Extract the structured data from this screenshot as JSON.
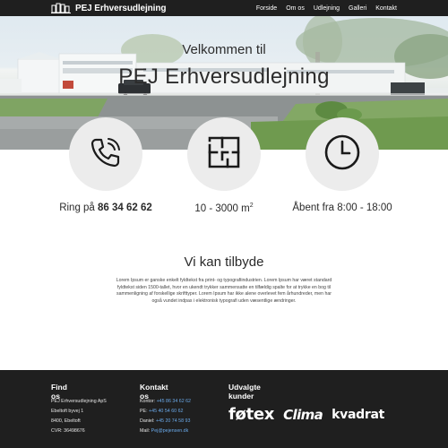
{
  "nav": {
    "brand": "PEJ Erhversudlejning",
    "menu": [
      "Forside",
      "Om os",
      "Udlejning",
      "Galleri",
      "Kontakt"
    ]
  },
  "hero": {
    "welcome": "Velkommen til",
    "title": "PEJ Erhversudlejning"
  },
  "features": {
    "phone_prefix": "Ring på",
    "phone_number": "86 34 62 62",
    "area": "10 - 3000 m",
    "area_unit_sup": "2",
    "hours": "Åbent fra 8:00 - 18:00"
  },
  "about": {
    "title": "Vi kan tilbyde",
    "text": "Lorem Ipsum er ganske enkelt fyldtekst fra print- og typografiindustrien. Lorem Ipsum har været standard fyldtekst siden 1500-tallet, hvor en ukendt trykker sammensatte en tilfældig spalte for at trykke en bog til sammenligning af forskellige skrifttyper. Lorem Ipsum har ikke alene overlevet fem århundreder, men har også vundet indpas i elektronisk typografi uden væsentlige ændringer."
  },
  "footer": {
    "find_title": "Find os",
    "address": [
      "PEJ Erhversudlejning ApS",
      "Ebeltoft byvej 1",
      "8400, Ebeltoft",
      "CVR: 36498676"
    ],
    "contact_title": "Kontakt os",
    "contacts": [
      {
        "label": "Kontor:",
        "value": "+45 86 34 62 62"
      },
      {
        "label": "PE:",
        "value": "+45 40 54 60 62"
      },
      {
        "label": "Daniel:",
        "value": "+45 20 74 58 93"
      },
      {
        "label": "Mail:",
        "value": "Pej@pejensen.dk"
      }
    ],
    "customers_title": "Udvalgte kunder",
    "customers": [
      "føtex",
      "Clima",
      "kvadrat"
    ]
  },
  "colors": {
    "nav_bg": "#1f1f1f",
    "footer_bg": "#1f1f1f",
    "circle_bg": "#ececec",
    "link": "#6aa9e9"
  },
  "icons": [
    "logo-buildings-icon",
    "phone-icon",
    "floorplan-icon",
    "clock-icon"
  ]
}
